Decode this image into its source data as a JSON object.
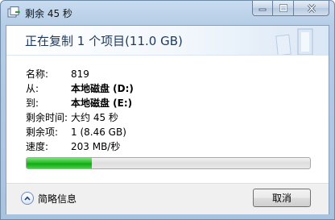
{
  "window": {
    "title": "剩余 45 秒"
  },
  "dialog": {
    "headline": "正在复制 1 个项目(11.0 GB)",
    "info": [
      {
        "label": "名称:",
        "value": "819",
        "bold": false
      },
      {
        "label": "从:",
        "value": "本地磁盘 (D:)",
        "bold": true
      },
      {
        "label": "到:",
        "value": "本地磁盘 (E:)",
        "bold": true
      },
      {
        "label": "剩余时间:",
        "value": "大约 45 秒",
        "bold": false
      },
      {
        "label": "剩余项:",
        "value": "1 (8.46 GB)",
        "bold": false
      },
      {
        "label": "速度:",
        "value": "203 MB/秒",
        "bold": false
      }
    ],
    "progress_fraction": 0.23
  },
  "footer": {
    "details_label": "简略信息",
    "cancel_label": "取消"
  },
  "icons": {
    "app": "copy-files-icon",
    "minimize": "minimize-icon",
    "maximize": "maximize-icon",
    "close": "close-icon",
    "collapse": "chevron-up-icon"
  },
  "colors": {
    "progress_green": "#26bf26",
    "headline_text": "#1e395b"
  }
}
